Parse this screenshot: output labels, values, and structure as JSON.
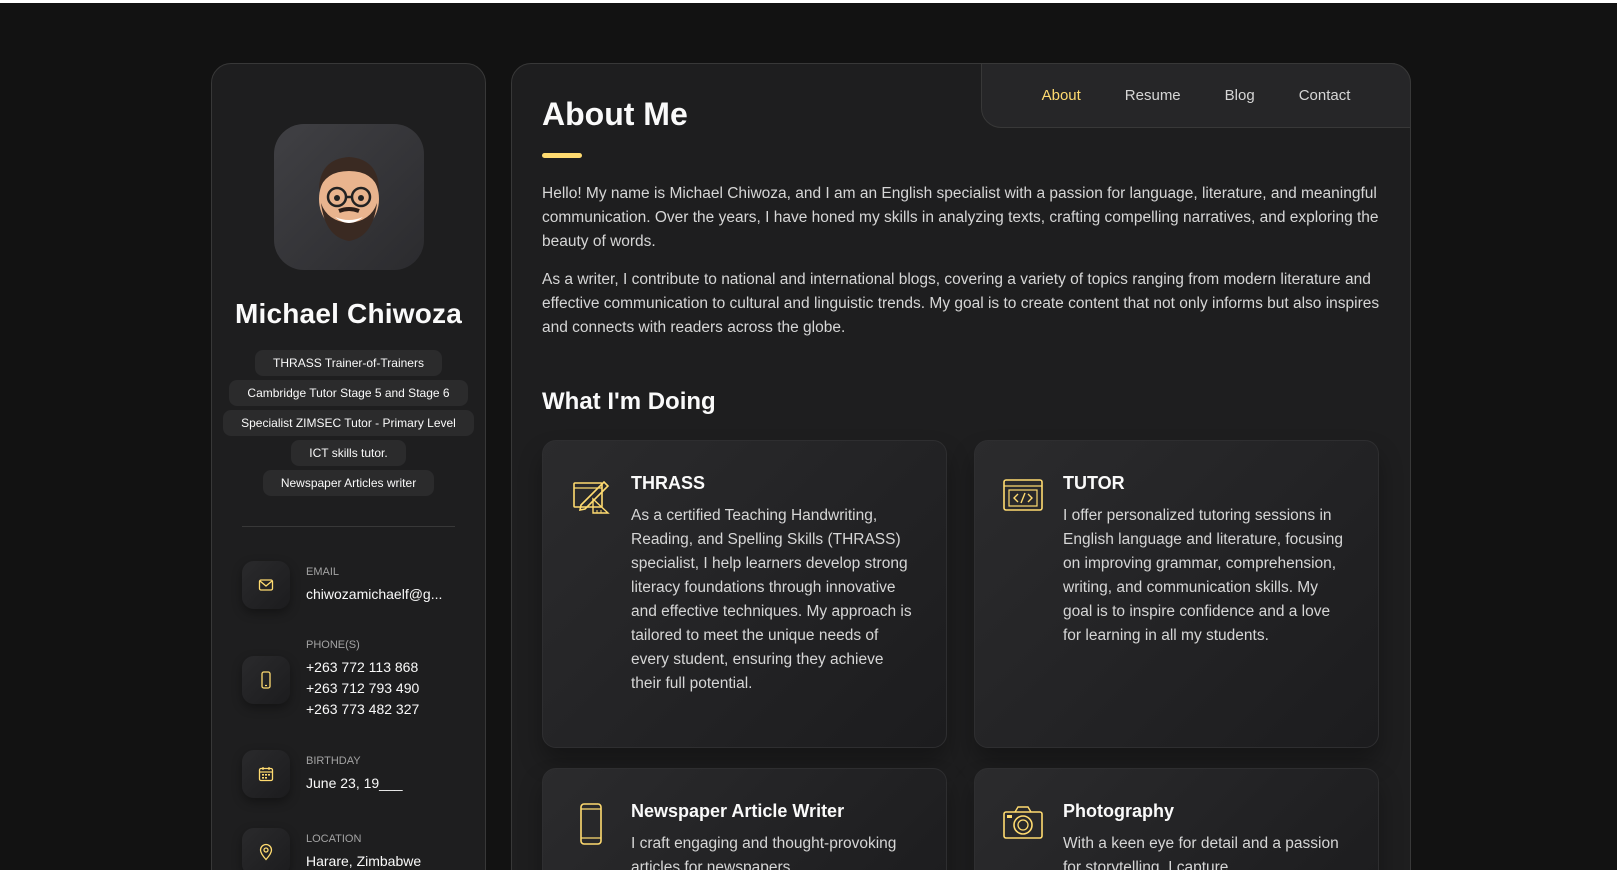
{
  "colors": {
    "accent": "#ffdb70",
    "background": "#121212",
    "panel": "#1e1e1f"
  },
  "profile": {
    "name": "Michael Chiwoza",
    "titles": [
      "THRASS Trainer-of-Trainers",
      "Cambridge Tutor Stage 5 and Stage 6",
      "Specialist ZIMSEC Tutor - Primary Level",
      "ICT skills tutor.",
      "Newspaper Articles writer"
    ]
  },
  "contacts": {
    "email": {
      "label": "EMAIL",
      "value": "chiwozamichaelf@g...",
      "icon": "mail-icon"
    },
    "phones": {
      "label": "PHONE(S)",
      "values": [
        "+263 772 113 868",
        "+263 712 793 490",
        "+263 773 482 327"
      ],
      "icon": "phone-icon"
    },
    "birthday": {
      "label": "BIRTHDAY",
      "value": "June 23, 19___",
      "icon": "calendar-icon"
    },
    "location": {
      "label": "LOCATION",
      "value": "Harare, Zimbabwe",
      "icon": "location-pin-icon"
    }
  },
  "nav": {
    "active": "About",
    "items": [
      "About",
      "Resume",
      "Blog",
      "Contact"
    ]
  },
  "about": {
    "heading": "About Me",
    "paragraphs": [
      "Hello! My name is Michael Chiwoza, and I am an English specialist with a passion for language, literature, and meaningful communication. Over the years, I have honed my skills in analyzing texts, crafting compelling narratives, and exploring the beauty of words.",
      "As a writer, I contribute to national and international blogs, covering a variety of topics ranging from modern literature and effective communication to cultural and linguistic trends. My goal is to create content that not only informs but also inspires and connects with readers across the globe."
    ]
  },
  "doing": {
    "heading": "What I'm Doing",
    "services": [
      {
        "title": "THRASS",
        "icon": "design-pencil-icon",
        "text": "As a certified Teaching Handwriting, Reading, and Spelling Skills (THRASS) specialist, I help learners develop strong literacy foundations through innovative and effective techniques. My approach is tailored to meet the unique needs of every student, ensuring they achieve their full potential."
      },
      {
        "title": "TUTOR",
        "icon": "code-window-icon",
        "text": "I offer personalized tutoring sessions in English language and literature, focusing on improving grammar, comprehension, writing, and communication skills. My goal is to inspire confidence and a love for learning in all my students."
      },
      {
        "title": "Newspaper Article Writer",
        "icon": "smartphone-icon",
        "text": "I craft engaging and thought-provoking articles for newspapers,"
      },
      {
        "title": "Photography",
        "icon": "camera-icon",
        "text": "With a keen eye for detail and a passion for storytelling, I capture"
      }
    ]
  }
}
